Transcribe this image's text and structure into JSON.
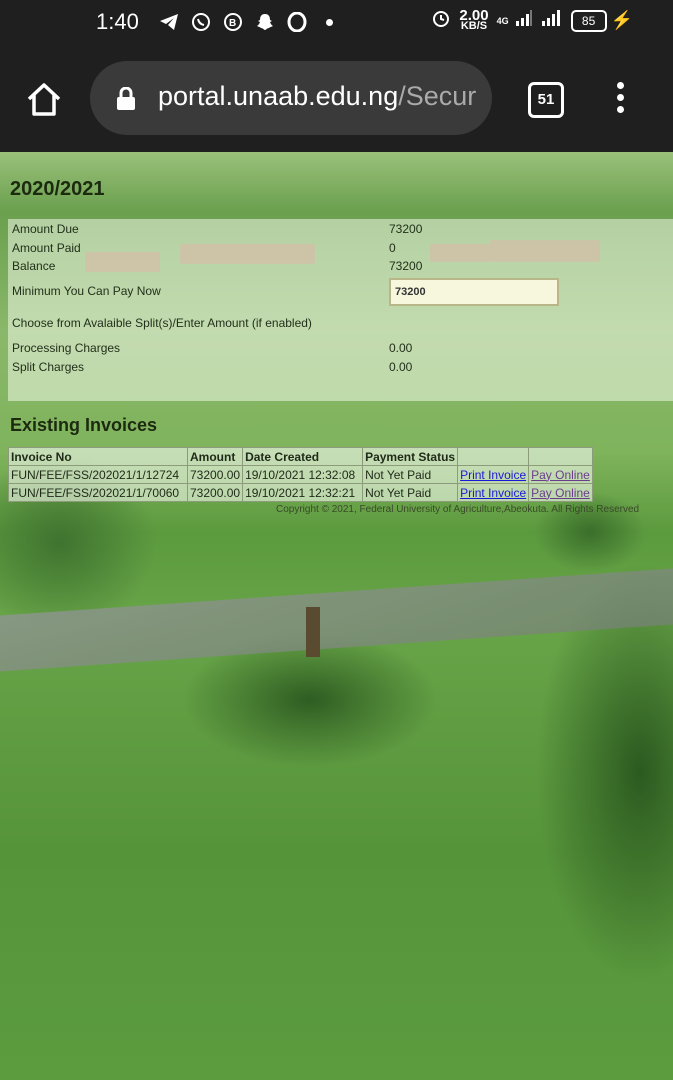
{
  "status_bar": {
    "time": "1:40",
    "speed_value": "2.00",
    "speed_unit": "KB/S",
    "network": "4G",
    "battery": "85"
  },
  "browser": {
    "url_domain": "portal.unaab.edu.ng",
    "url_path": "/Secur",
    "tab_count": "51"
  },
  "page": {
    "session": "2020/2021",
    "summary": [
      {
        "label": "Amount Due",
        "value": "73200"
      },
      {
        "label": "Amount Paid",
        "value": "0"
      },
      {
        "label": "Balance",
        "value": "73200"
      }
    ],
    "min_pay_label": "Minimum You Can Pay Now",
    "min_pay_value": "73200",
    "split_label": "Choose from Avalaible Split(s)/Enter Amount (if enabled)",
    "processing_label": "Processing Charges",
    "processing_value": "0.00",
    "split_charges_label": "Split Charges",
    "split_charges_value": "0.00",
    "invoices_title": "Existing Invoices",
    "invoice_headers": [
      "Invoice No",
      "Amount",
      "Date Created",
      "Payment Status",
      "",
      ""
    ],
    "invoices": [
      {
        "no": "FUN/FEE/FSS/202021/1/12724",
        "amount": "73200.00",
        "date": "19/10/2021 12:32:08",
        "status": "Not Yet Paid",
        "print": "Print Invoice",
        "pay": "Pay Online"
      },
      {
        "no": "FUN/FEE/FSS/202021/1/70060",
        "amount": "73200.00",
        "date": "19/10/2021 12:32:21",
        "status": "Not Yet Paid",
        "print": "Print Invoice",
        "pay": "Pay Online"
      }
    ],
    "copyright": "Copyright © 2021, Federal University of Agriculture,Abeokuta. All Rights Reserved"
  }
}
